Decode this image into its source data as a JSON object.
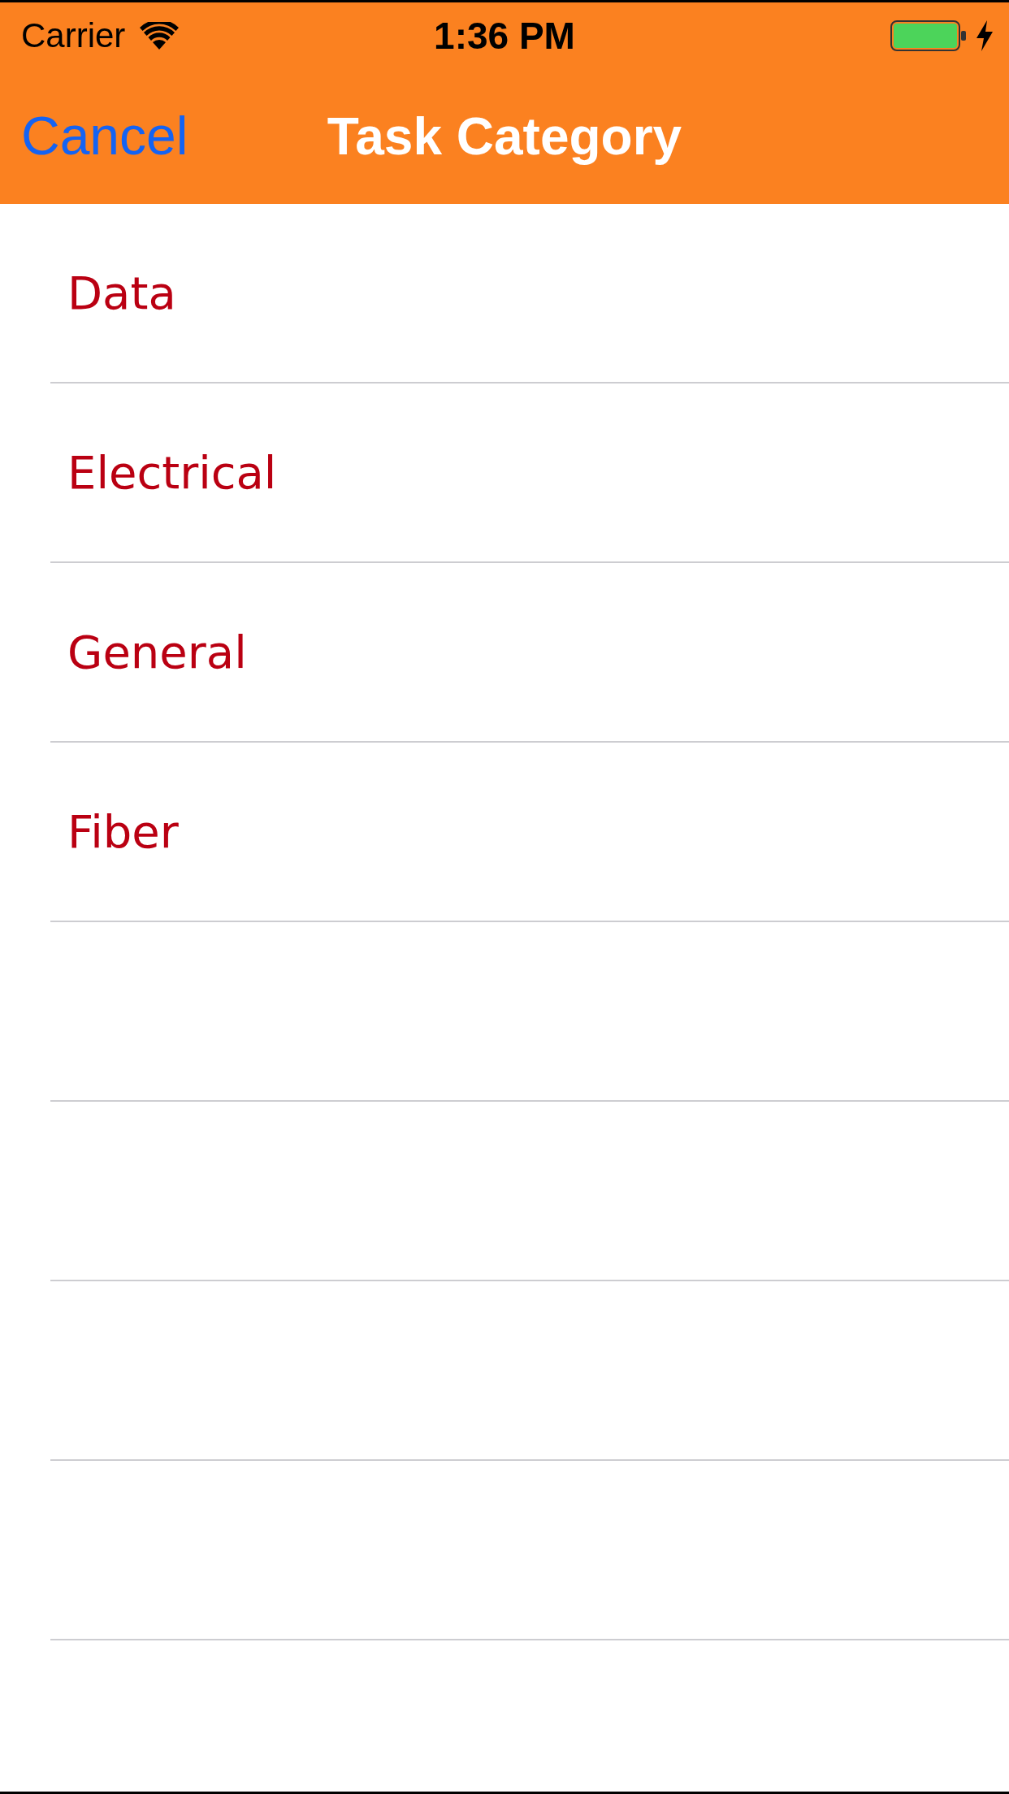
{
  "status_bar": {
    "carrier": "Carrier",
    "time": "1:36 PM"
  },
  "nav_bar": {
    "cancel": "Cancel",
    "title": "Task Category"
  },
  "categories": [
    {
      "label": "Data"
    },
    {
      "label": "Electrical"
    },
    {
      "label": "General"
    },
    {
      "label": "Fiber"
    }
  ]
}
